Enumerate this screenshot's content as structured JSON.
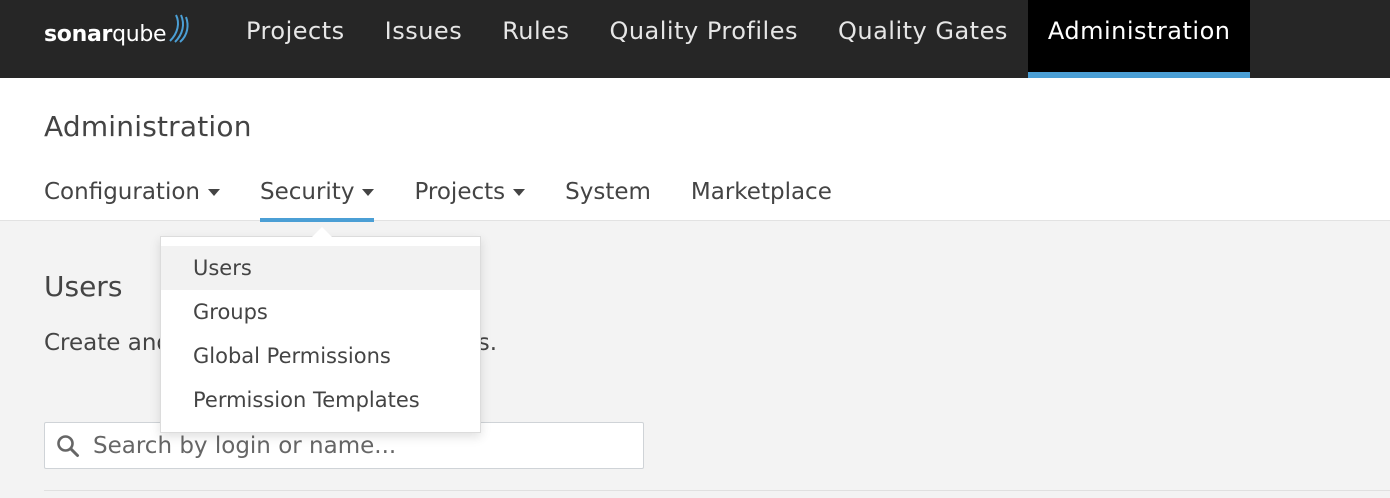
{
  "brand": {
    "logo_bold": "sonar",
    "logo_thin": "qube"
  },
  "topnav": {
    "items": [
      {
        "label": "Projects"
      },
      {
        "label": "Issues"
      },
      {
        "label": "Rules"
      },
      {
        "label": "Quality Profiles"
      },
      {
        "label": "Quality Gates"
      },
      {
        "label": "Administration",
        "active": true
      }
    ]
  },
  "header": {
    "title": "Administration",
    "subnav": [
      {
        "label": "Configuration",
        "has_caret": true
      },
      {
        "label": "Security",
        "has_caret": true,
        "active": true
      },
      {
        "label": "Projects",
        "has_caret": true
      },
      {
        "label": "System"
      },
      {
        "label": "Marketplace"
      }
    ]
  },
  "dropdown": {
    "items": [
      {
        "label": "Users",
        "highlighted": true
      },
      {
        "label": "Groups"
      },
      {
        "label": "Global Permissions"
      },
      {
        "label": "Permission Templates"
      }
    ]
  },
  "main": {
    "title": "Users",
    "description": "Create and administer individual users."
  },
  "search": {
    "placeholder": "Search by login or name...",
    "value": ""
  },
  "colors": {
    "topnav_bg": "#262626",
    "active_tab_bg": "#000000",
    "accent": "#4b9fd5",
    "page_bg": "#f3f3f3"
  }
}
